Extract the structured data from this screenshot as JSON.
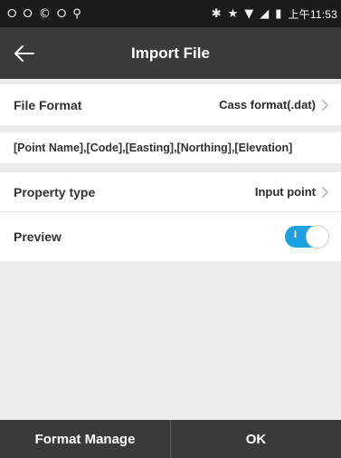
{
  "status_bar": {
    "left_icons": [
      "⭘",
      "⭘",
      "©",
      "⭘",
      "⚲"
    ],
    "right_icons": [
      "✱",
      "★",
      "▼",
      "◢",
      "▮"
    ],
    "time": "上午11:53"
  },
  "header": {
    "title": "Import File",
    "back_icon": "arrow-left-icon"
  },
  "settings": {
    "file_format": {
      "label": "File Format",
      "value": "Cass format(.dat)"
    },
    "fields": "[Point Name],[Code],[Easting],[Northing],[Elevation]",
    "property_type": {
      "label": "Property type",
      "value": "Input point"
    },
    "preview": {
      "label": "Preview",
      "toggle_text": "I",
      "enabled": true
    }
  },
  "footer": {
    "format_manage_label": "Format Manage",
    "ok_label": "OK"
  },
  "colors": {
    "status_bar": "#1b1b1b",
    "title_bar": "#3a3a3a",
    "toggle_on": "#1ba1e2",
    "background": "#ececec"
  }
}
